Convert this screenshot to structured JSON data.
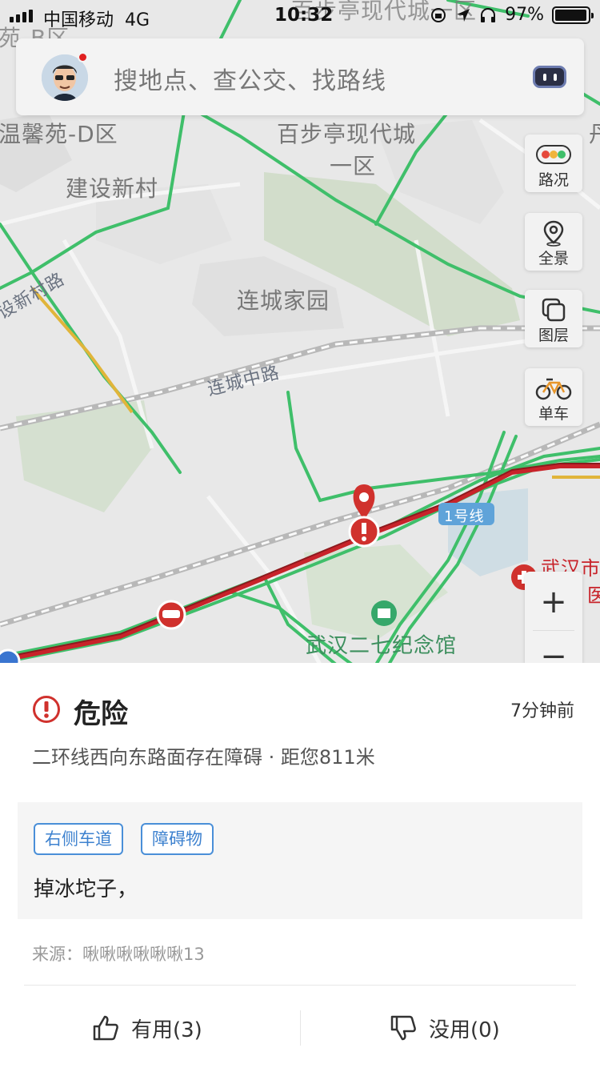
{
  "status_bar": {
    "carrier": "中国移动",
    "network": "4G",
    "time": "10:32",
    "battery": "97%",
    "battery_level": 0.97
  },
  "search": {
    "placeholder": "搜地点、查公交、找路线"
  },
  "map": {
    "labels": {
      "top_left": "苑-B区",
      "top_right": "百步亭现代城一区",
      "wenxinyuan": "温馨苑-D区",
      "baibuting_1": "百步亭现代城",
      "baibuting_2": "一区",
      "jianshe": "建设新村",
      "lianchengjiayuan": "连城家园",
      "xincun_road": "设新村路",
      "liancheng_road": "连城中路",
      "line1": "1号线",
      "hospital_1": "武汉市",
      "hospital_2": "医",
      "memorial": "武汉二七纪念馆",
      "edge_char": "丹"
    }
  },
  "side_buttons": {
    "traffic": "路况",
    "panorama": "全景",
    "layers": "图层",
    "bike": "单车"
  },
  "zoom": {
    "plus": "+",
    "minus": "−"
  },
  "event": {
    "title": "危险",
    "time_ago": "7分钟前",
    "description": "二环线西向东路面存在障碍 · 距您811米",
    "tags": [
      "右侧车道",
      "障碍物"
    ],
    "detail": "掉冰坨子，",
    "source": "来源：啾啾啾啾啾啾13"
  },
  "feedback": {
    "useful": "有用(3)",
    "useless": "没用(0)"
  },
  "colors": {
    "danger": "#d0312d",
    "tag_blue": "#3e82cf",
    "road_green": "#3fbf6a"
  }
}
